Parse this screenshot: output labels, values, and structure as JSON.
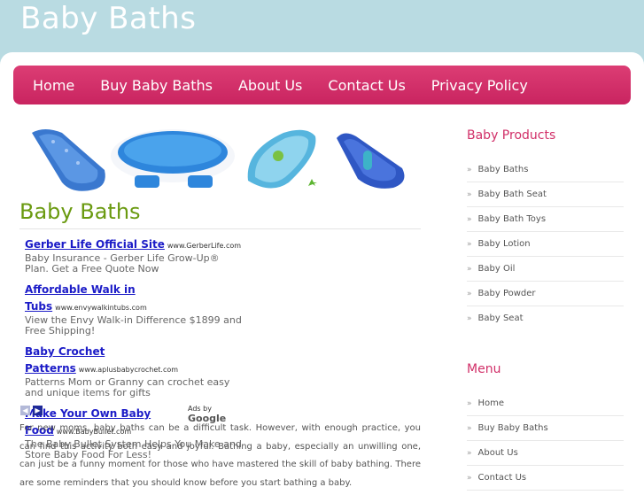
{
  "site_title": "Baby Baths",
  "nav": [
    "Home",
    "Buy Baby Baths",
    "About Us",
    "Contact Us",
    "Privacy Policy"
  ],
  "main_heading": "Baby Baths",
  "ads": [
    {
      "title": "Gerber Life Official Site",
      "url": "www.GerberLife.com",
      "desc": "Baby Insurance - Gerber Life Grow-Up® Plan. Get a Free Quote Now"
    },
    {
      "title": "Affordable Walk in Tubs",
      "url": "www.envywalkintubs.com",
      "desc": "View the Envy Walk-in Difference $1899 and Free Shipping!"
    },
    {
      "title": "Baby Crochet Patterns",
      "url": "www.aplusbabycrochet.com",
      "desc": "Patterns Mom or Granny can crochet easy and unique items for gifts"
    },
    {
      "title": "Make Your Own Baby Food",
      "url": "www.BabyBullet.com",
      "desc": "The Baby Bullet System Helps You Make and Store Baby Food For Less!"
    }
  ],
  "ads_by": {
    "prefix": "Ads by",
    "brand": "Google"
  },
  "arrows": {
    "prev": "◀",
    "next": "▶"
  },
  "body_text": "For new moms, baby baths can be a difficult task. However, with enough practice, you can find this activity both easy and joyful. Bathing a baby, especially an unwilling one, can just be a funny moment for those who have mastered the skill of baby bathing. There are some reminders that you should know before you start bathing a baby.",
  "sidebar": {
    "products_title": "Baby Products",
    "products": [
      "Baby Baths",
      "Baby Bath Seat",
      "Baby Bath Toys",
      "Baby Lotion",
      "Baby Oil",
      "Baby Powder",
      "Baby Seat"
    ],
    "menu_title": "Menu",
    "menu": [
      "Home",
      "Buy Baby Baths",
      "About Us",
      "Contact Us"
    ],
    "bullet": "»"
  },
  "colors": {
    "accent": "#d12f68",
    "heading_green": "#6a9a10",
    "sky": "#b9dbe2",
    "ad_link": "#1b1bc7"
  }
}
